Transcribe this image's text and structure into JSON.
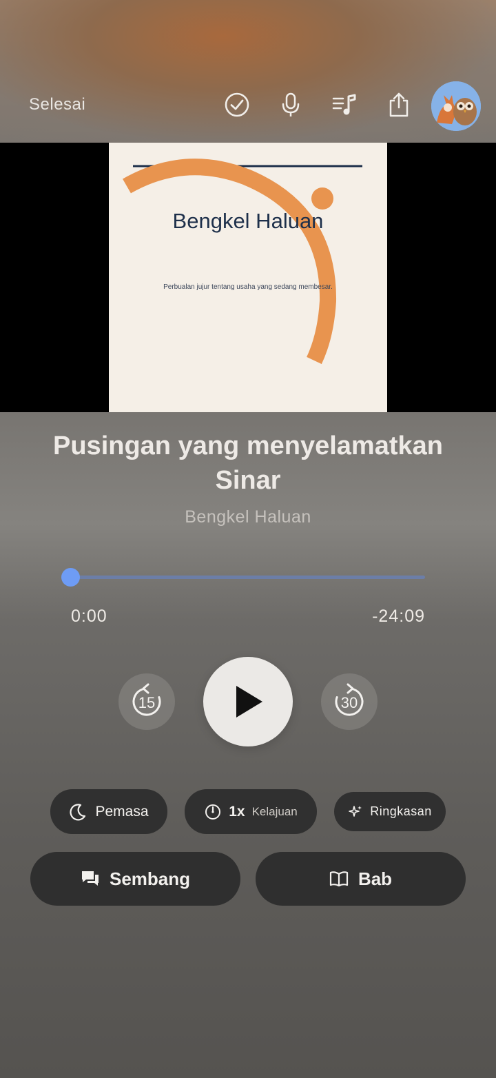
{
  "header": {
    "done_label": "Selesai",
    "icons": [
      "checkmark-circle-icon",
      "microphone-icon",
      "queue-music-icon",
      "share-icon",
      "avatar"
    ]
  },
  "artwork": {
    "title": "Bengkel Haluan",
    "subtitle": "Perbualan jujur tentang usaha yang sedang membesar."
  },
  "episode": {
    "title": "Pusingan yang menyelamatkan Sinar",
    "show": "Bengkel Haluan"
  },
  "player": {
    "elapsed": "0:00",
    "remaining": "-24:09",
    "progress": 0,
    "skip_back_seconds": "15",
    "skip_forward_seconds": "30"
  },
  "actions": {
    "timer_label": "Pemasa",
    "speed_value": "1x",
    "speed_label": "Kelajuan",
    "summary_label": "Ringkasan",
    "chat_label": "Sembang",
    "chapters_label": "Bab"
  },
  "colors": {
    "accent": "#6e9cf5",
    "cover_orange": "#e8944f",
    "cover_navy": "#1d2f4a"
  }
}
